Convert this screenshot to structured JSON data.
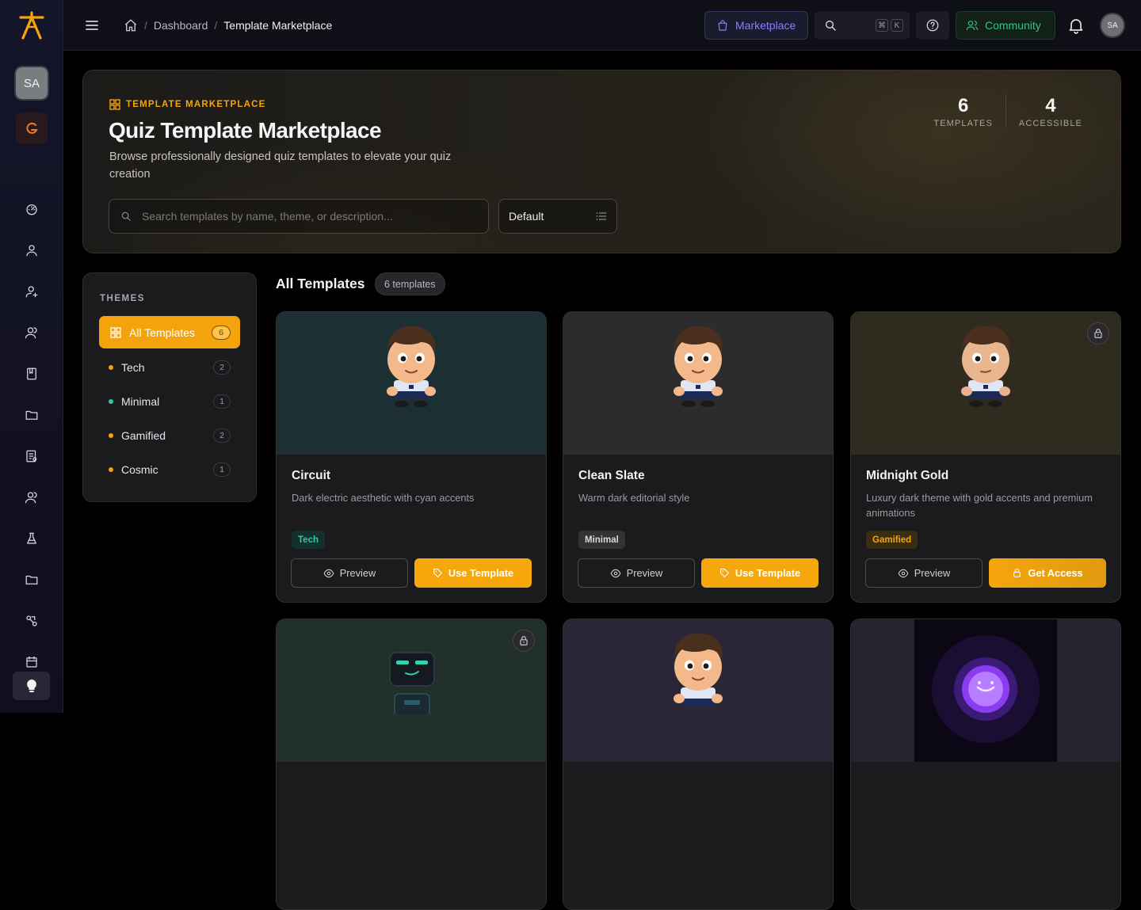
{
  "sidebar": {
    "avatar_initials": "SA",
    "nav_icons": [
      "dashboard-icon",
      "user-icon",
      "user-plus-icon",
      "users-icon",
      "book-icon",
      "folder-icon",
      "quiz-list-icon",
      "user-group-icon",
      "flask-icon",
      "folder-icon-2",
      "share-icon",
      "calendar-icon"
    ],
    "bottom_icon": "lightbulb-icon"
  },
  "topbar": {
    "breadcrumb": {
      "home_icon": "home-icon",
      "parent": "Dashboard",
      "current": "Template Marketplace",
      "separator": "/"
    },
    "marketplace_label": "Marketplace",
    "shortcut_keys": [
      "⌘",
      "K"
    ],
    "community_label": "Community",
    "avatar_initials": "SA"
  },
  "hero": {
    "tag": "TEMPLATE MARKETPLACE",
    "title": "Quiz Template Marketplace",
    "description": "Browse professionally designed quiz templates to elevate your quiz creation",
    "search_placeholder": "Search templates by name, theme, or description...",
    "sort_value": "Default",
    "stats": [
      {
        "value": "6",
        "label": "TEMPLATES"
      },
      {
        "value": "4",
        "label": "ACCESSIBLE"
      }
    ]
  },
  "themes": {
    "title": "THEMES",
    "all": {
      "label": "All Templates",
      "count": "6"
    },
    "items": [
      {
        "label": "Tech",
        "count": "2",
        "color": "#f5a30d"
      },
      {
        "label": "Minimal",
        "count": "1",
        "color": "#2fc6a8"
      },
      {
        "label": "Gamified",
        "count": "2",
        "color": "#f5a30d"
      },
      {
        "label": "Cosmic",
        "count": "1",
        "color": "#f5a30d"
      }
    ]
  },
  "section": {
    "title": "All Templates",
    "badge": "6 templates"
  },
  "cards": [
    {
      "title": "Circuit",
      "description": "Dark electric aesthetic with cyan accents",
      "tag": "Tech",
      "preview_label": "Preview",
      "action_label": "Use Template",
      "locked": false,
      "media_color": "#1c2f33",
      "tag_color": "#2fc6a8"
    },
    {
      "title": "Clean Slate",
      "description": "Warm dark editorial style",
      "tag": "Minimal",
      "preview_label": "Preview",
      "action_label": "Use Template",
      "locked": false,
      "media_color": "#2c2c2e",
      "tag_color": "#d8d8dc"
    },
    {
      "title": "Midnight Gold",
      "description": "Luxury dark theme with gold accents and premium animations",
      "tag": "Gamified",
      "preview_label": "Preview",
      "action_label": "Get Access",
      "locked": true,
      "media_color": "#302b1f",
      "tag_color": "#f5a30d"
    },
    {
      "locked": true,
      "media_color": "#21302a"
    },
    {
      "locked": false,
      "media_color": "#2b2538"
    },
    {
      "locked": false,
      "media_color": "#27222f"
    }
  ]
}
